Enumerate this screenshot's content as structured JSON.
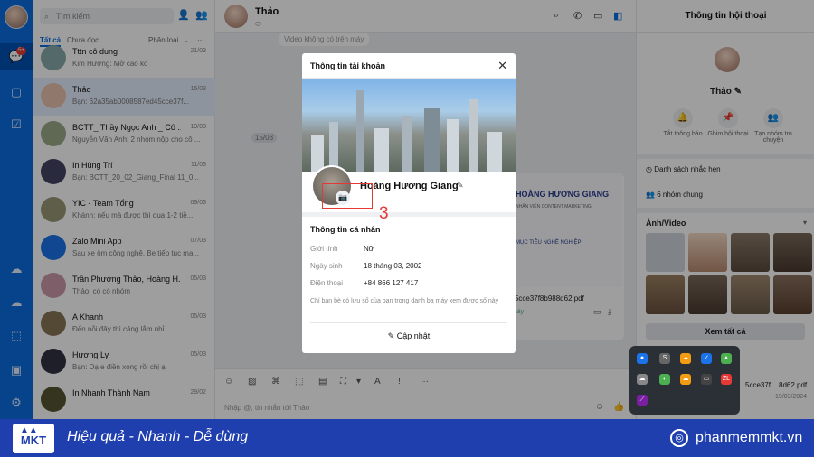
{
  "sidebar": {
    "badge": "5+"
  },
  "list": {
    "search_placeholder": "Tìm kiếm",
    "tabs": [
      "Tất cả",
      "Chưa đọc",
      "Phân loại"
    ],
    "conversations": [
      {
        "name": "Tttn cô dung",
        "msg": "Kim Hường: Mở cao ko",
        "time": "21/03",
        "color": "#8aa"
      },
      {
        "name": "Thảo",
        "msg": "Bạn: 62a35ab0008587ed45cce37f...",
        "time": "15/03",
        "color": "#e9c2ae"
      },
      {
        "name": "BCTT_ Thầy Ngọc Anh _ Cô ...",
        "msg": "Nguyễn Văn Anh: 2 nhóm nộp cho cô ...",
        "time": "19/03",
        "color": "#9a8"
      },
      {
        "name": "In Hùng Trí",
        "msg": "Bạn: BCTT_20_02_Giang_Final 11_0...",
        "time": "11/03",
        "color": "#446"
      },
      {
        "name": "YIC - Team Tổng",
        "msg": "Khánh: nếu mà được thì qua 1-2 tiề...",
        "time": "09/03",
        "color": "#997"
      },
      {
        "name": "Zalo Mini App",
        "msg": "Sau xe ôm công nghệ, Be tiếp tục ma...",
        "time": "07/03",
        "color": "#1a73e8"
      },
      {
        "name": "Trần Phương Thảo, Hoàng H...",
        "msg": "Thảo: có có nhóm",
        "time": "05/03",
        "color": "#c9a"
      },
      {
        "name": "A Khanh",
        "msg": "Đến nỗi đây thì căng lắm nhỉ",
        "time": "05/03",
        "color": "#875"
      },
      {
        "name": "Hương Ly",
        "msg": "Bạn: Dạ e điền xong rồi chị ạ",
        "time": "05/03",
        "color": "#334"
      },
      {
        "name": "In Nhanh Thành Nam",
        "msg": "",
        "time": "29/02",
        "color": "#553"
      }
    ]
  },
  "chat": {
    "name": "Thảo",
    "video_note": "Video không có trên máy",
    "date_chip": "15/03",
    "file_name": "d45cce37f8b988d62.pdf",
    "file_status": "n máy",
    "doc_title": "HOÀNG HƯƠNG GIANG",
    "doc_sub": "NHÂN VIÊN CONTENT MARKETING",
    "doc_goal": "MỤC TIÊU NGHỀ NGHIỆP",
    "input_placeholder": "Nhập @, tin nhắn tới Thảo"
  },
  "info": {
    "title": "Thông tin hội thoại",
    "name": "Thảo",
    "actions": [
      "Tắt thông báo",
      "Ghim hội thoại",
      "Tạo nhóm trò chuyện"
    ],
    "reminders": "Danh sách nhắc hẹn",
    "common_groups": "6 nhóm chung",
    "media_title": "Ảnh/Video",
    "see_all": "Xem tất cả",
    "file_name": "8d62.pdf",
    "file_date": "19/03/2024",
    "file_prefix": "5cce37f..."
  },
  "modal": {
    "title": "Thông tin tài khoản",
    "name": "Hoàng Hương Giang",
    "section": "Thông tin cá nhân",
    "gender_label": "Giới tính",
    "gender": "Nữ",
    "dob_label": "Ngày sinh",
    "dob": "18 tháng 03, 2002",
    "phone_label": "Điện thoại",
    "phone": "+84 866 127 417",
    "note": "Chỉ bạn bè có lưu số của bạn trong danh bạ máy xem được số này",
    "update": "Cập nhật"
  },
  "annotation": {
    "step": "3",
    "color": "#e53935"
  },
  "banner": {
    "logo": "MKT",
    "slogan": "Hiệu quả - Nhanh - Dễ dùng",
    "site": "phanmemmkt.vn",
    "color": "#1f3fae"
  }
}
